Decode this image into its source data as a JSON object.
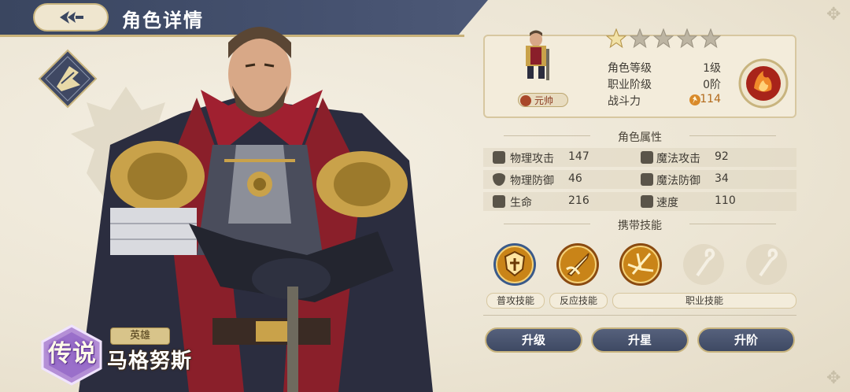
{
  "header": {
    "title": "角色详情"
  },
  "hero": {
    "rarity": "传说",
    "type": "英雄",
    "name": "马格努斯",
    "stars_filled": 1,
    "stars_total": 5
  },
  "info": {
    "class_tag": "元帅",
    "rows": [
      {
        "label": "角色等级",
        "value": "1级"
      },
      {
        "label": "职业阶级",
        "value": "0阶"
      },
      {
        "label": "战斗力",
        "value": "114"
      }
    ]
  },
  "attributes": {
    "title": "角色属性",
    "rows": [
      [
        {
          "icon": "sword-icon",
          "label": "物理攻击",
          "value": "147"
        },
        {
          "icon": "wand-icon",
          "label": "魔法攻击",
          "value": "92"
        }
      ],
      [
        {
          "icon": "shield-icon",
          "label": "物理防御",
          "value": "46"
        },
        {
          "icon": "magic-shield-icon",
          "label": "魔法防御",
          "value": "34"
        }
      ],
      [
        {
          "icon": "heart-icon",
          "label": "生命",
          "value": "216"
        },
        {
          "icon": "boot-icon",
          "label": "速度",
          "value": "110"
        }
      ]
    ]
  },
  "skills": {
    "title": "携带技能",
    "labels": {
      "normal": "普攻技能",
      "reaction": "反应技能",
      "class": "职业技能"
    }
  },
  "actions": {
    "upgrade": "升级",
    "star_up": "升星",
    "advance": "升阶"
  },
  "colors": {
    "header": "#3a4660",
    "gold": "#c8b47e",
    "panel": "#f3ecdb",
    "button": "#465270"
  }
}
